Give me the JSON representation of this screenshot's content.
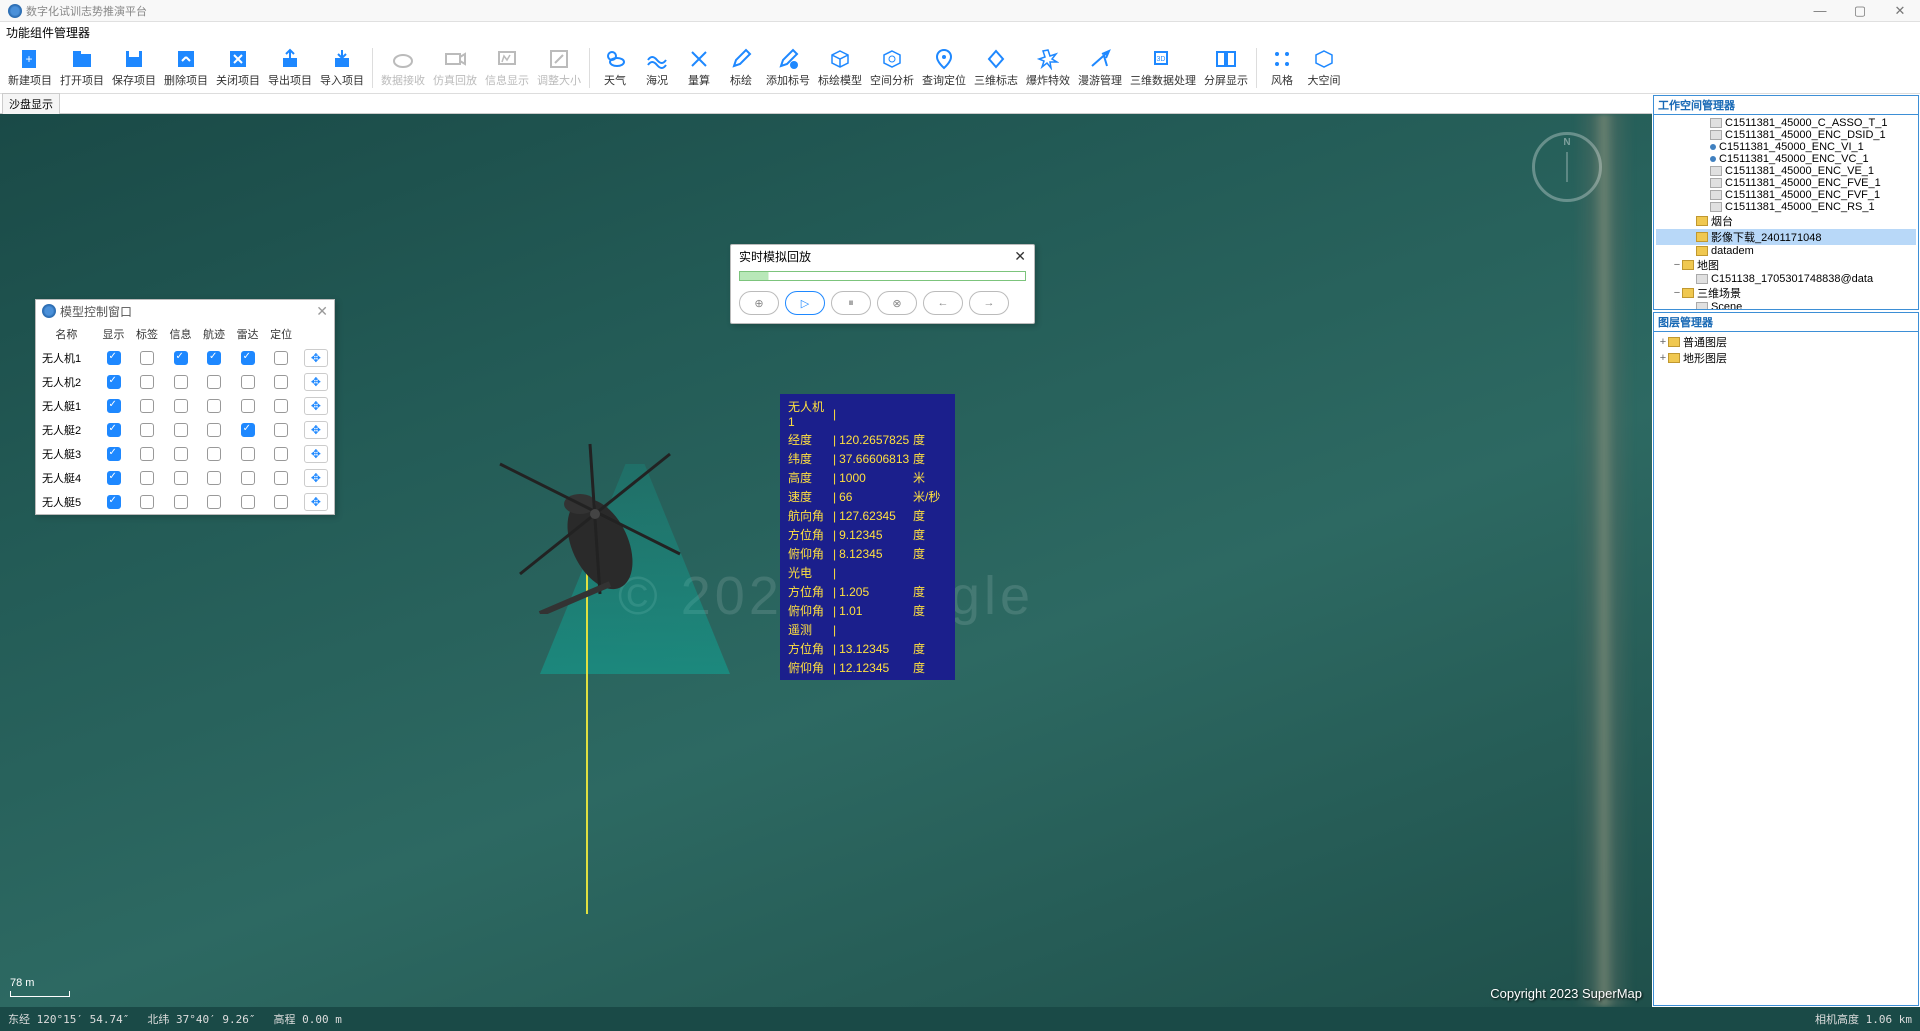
{
  "app_title": "数字化试训志势推演平台",
  "menu": "功能组件管理器",
  "toolbar": [
    {
      "label": "新建项目",
      "icon": "file-plus",
      "dis": false
    },
    {
      "label": "打开项目",
      "icon": "folder",
      "dis": false
    },
    {
      "label": "保存项目",
      "icon": "save",
      "dis": false
    },
    {
      "label": "删除项目",
      "icon": "delete",
      "dis": false
    },
    {
      "label": "关闭项目",
      "icon": "close-box",
      "dis": false
    },
    {
      "label": "导出项目",
      "icon": "export",
      "dis": false
    },
    {
      "label": "导入项目",
      "icon": "import",
      "dis": false
    },
    {
      "sep": true
    },
    {
      "label": "数据接收",
      "icon": "cloud",
      "dis": true
    },
    {
      "label": "仿真回放",
      "icon": "camera",
      "dis": true
    },
    {
      "label": "信息显示",
      "icon": "monitor",
      "dis": true
    },
    {
      "label": "调整大小",
      "icon": "resize",
      "dis": true
    },
    {
      "sep": true
    },
    {
      "label": "天气",
      "icon": "weather",
      "dis": false
    },
    {
      "label": "海况",
      "icon": "wave",
      "dis": false
    },
    {
      "label": "量算",
      "icon": "ruler",
      "dis": false
    },
    {
      "label": "标绘",
      "icon": "edit",
      "dis": false
    },
    {
      "label": "添加标号",
      "icon": "marker-add",
      "dis": false
    },
    {
      "label": "标绘模型",
      "icon": "cube",
      "dis": false
    },
    {
      "label": "空间分析",
      "icon": "cube3d",
      "dis": false
    },
    {
      "label": "查询定位",
      "icon": "pin",
      "dis": false
    },
    {
      "label": "三维标志",
      "icon": "sign3d",
      "dis": false
    },
    {
      "label": "爆炸特效",
      "icon": "blast",
      "dis": false
    },
    {
      "label": "漫游管理",
      "icon": "plane",
      "dis": false
    },
    {
      "label": "三维数据处理",
      "icon": "data3d",
      "dis": false
    },
    {
      "label": "分屏显示",
      "icon": "split",
      "dis": false
    },
    {
      "sep": true
    },
    {
      "label": "风格",
      "icon": "style",
      "dis": false
    },
    {
      "label": "大空间",
      "icon": "space",
      "dis": false
    }
  ],
  "tab_label": "沙盘显示",
  "modelwin": {
    "title": "模型控制窗口",
    "cols": [
      "名称",
      "显示",
      "标签",
      "信息",
      "航迹",
      "雷达",
      "定位"
    ],
    "rows": [
      {
        "name": "无人机1",
        "c": [
          true,
          false,
          true,
          true,
          true,
          false
        ]
      },
      {
        "name": "无人机2",
        "c": [
          true,
          false,
          false,
          false,
          false,
          false
        ]
      },
      {
        "name": "无人艇1",
        "c": [
          true,
          false,
          false,
          false,
          false,
          false
        ]
      },
      {
        "name": "无人艇2",
        "c": [
          true,
          false,
          false,
          false,
          true,
          false
        ]
      },
      {
        "name": "无人艇3",
        "c": [
          true,
          false,
          false,
          false,
          false,
          false
        ]
      },
      {
        "name": "无人艇4",
        "c": [
          true,
          false,
          false,
          false,
          false,
          false
        ]
      },
      {
        "name": "无人艇5",
        "c": [
          true,
          false,
          false,
          false,
          false,
          false
        ]
      }
    ]
  },
  "playwin": {
    "title": "实时模拟回放"
  },
  "info": {
    "title": "无人机1",
    "rows": [
      {
        "lbl": "经度",
        "val": "120.2657825",
        "unit": "度"
      },
      {
        "lbl": "纬度",
        "val": "37.66606813",
        "unit": "度"
      },
      {
        "lbl": "高度",
        "val": "1000",
        "unit": "米"
      },
      {
        "lbl": "速度",
        "val": "66",
        "unit": "米/秒"
      },
      {
        "lbl": "航向角",
        "val": "127.62345",
        "unit": "度"
      },
      {
        "lbl": "方位角",
        "val": "9.12345",
        "unit": "度"
      },
      {
        "lbl": "俯仰角",
        "val": "8.12345",
        "unit": "度"
      },
      {
        "lbl": "光电",
        "val": "",
        "unit": ""
      },
      {
        "lbl": "方位角",
        "val": "1.205",
        "unit": "度"
      },
      {
        "lbl": "俯仰角",
        "val": "1.01",
        "unit": "度"
      },
      {
        "lbl": "遥测",
        "val": "",
        "unit": ""
      },
      {
        "lbl": "方位角",
        "val": "13.12345",
        "unit": "度"
      },
      {
        "lbl": "俯仰角",
        "val": "12.12345",
        "unit": "度"
      }
    ]
  },
  "workspace": {
    "title": "工作空间管理器",
    "items": [
      {
        "indent": 3,
        "icon": "file",
        "label": "C1511381_45000_C_ASSO_T_1"
      },
      {
        "indent": 3,
        "icon": "file",
        "label": "C1511381_45000_ENC_DSID_1"
      },
      {
        "indent": 3,
        "icon": "dot",
        "label": "C1511381_45000_ENC_VI_1"
      },
      {
        "indent": 3,
        "icon": "dot",
        "label": "C1511381_45000_ENC_VC_1"
      },
      {
        "indent": 3,
        "icon": "line",
        "label": "C1511381_45000_ENC_VE_1"
      },
      {
        "indent": 3,
        "icon": "file",
        "label": "C1511381_45000_ENC_FVE_1"
      },
      {
        "indent": 3,
        "icon": "file",
        "label": "C1511381_45000_ENC_FVF_1"
      },
      {
        "indent": 3,
        "icon": "file",
        "label": "C1511381_45000_ENC_RS_1"
      },
      {
        "indent": 2,
        "icon": "folder",
        "label": "烟台"
      },
      {
        "indent": 2,
        "icon": "folder",
        "label": "影像下载_2401171048",
        "sel": true
      },
      {
        "indent": 2,
        "icon": "folder",
        "label": "datadem"
      },
      {
        "indent": 1,
        "icon": "folder",
        "label": "地图",
        "exp": "−"
      },
      {
        "indent": 2,
        "icon": "file",
        "label": "C151138_1705301748838@data"
      },
      {
        "indent": 1,
        "icon": "folder",
        "label": "三维场景",
        "exp": "−"
      },
      {
        "indent": 2,
        "icon": "file",
        "label": "Scene"
      }
    ]
  },
  "layers": {
    "title": "图层管理器",
    "items": [
      {
        "indent": 0,
        "icon": "folder",
        "label": "普通图层",
        "exp": "+"
      },
      {
        "indent": 0,
        "icon": "folder",
        "label": "地形图层",
        "exp": "+"
      }
    ]
  },
  "scale": "78 m",
  "copyright": "Copyright 2023 SuperMap",
  "watermark": "© 2024 Google",
  "compass_n": "N",
  "status": {
    "lon_lbl": "东经",
    "lon": "120°15′  54.74″",
    "lat_lbl": "北纬",
    "lat": "37°40′   9.26″",
    "alt_lbl": "高程",
    "alt": "0.00 m",
    "cam_lbl": "相机高度",
    "cam": "1.06 km"
  }
}
